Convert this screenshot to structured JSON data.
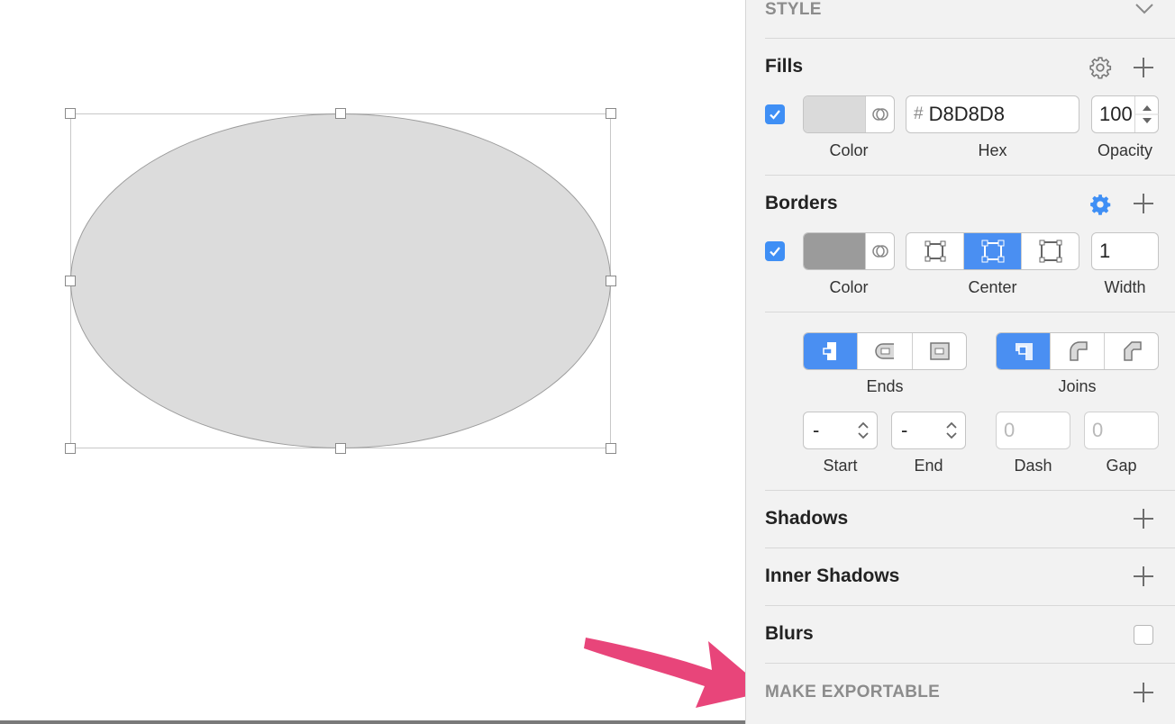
{
  "canvas": {
    "shape": "oval"
  },
  "panel": {
    "style_header": "STYLE",
    "fills": {
      "title": "Fills",
      "enabled": true,
      "color": "#D8D8D8",
      "hash": "#",
      "hex": "D8D8D8",
      "opacity": "100",
      "labels": {
        "color": "Color",
        "hex": "Hex",
        "opacity": "Opacity"
      }
    },
    "borders": {
      "title": "Borders",
      "enabled": true,
      "color": "#979797",
      "position_options": [
        "inside",
        "center",
        "outside"
      ],
      "position_selected": "center",
      "width": "1",
      "labels": {
        "color": "Color",
        "position": "Center",
        "width": "Width"
      }
    },
    "border_options": {
      "ends_label": "Ends",
      "joins_label": "Joins",
      "ends_selected": "butt",
      "joins_selected": "miter",
      "start_value": "-",
      "end_value": "-",
      "dash_value": "0",
      "gap_value": "0",
      "start_label": "Start",
      "end_label": "End",
      "dash_label": "Dash",
      "gap_label": "Gap"
    },
    "shadows": {
      "title": "Shadows"
    },
    "inner_shadows": {
      "title": "Inner Shadows"
    },
    "blurs": {
      "title": "Blurs",
      "enabled": false
    },
    "export": {
      "title": "MAKE EXPORTABLE"
    }
  },
  "colors": {
    "accent": "#4A8FF2",
    "arrow": "#E8457A"
  }
}
